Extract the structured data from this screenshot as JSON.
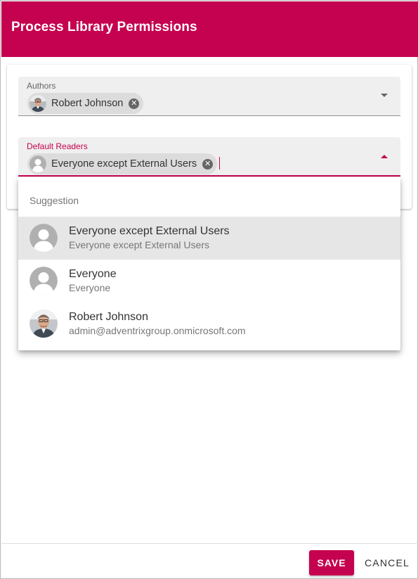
{
  "dialog": {
    "title": "Process Library Permissions",
    "accent_color": "#c5024f"
  },
  "authors": {
    "label": "Authors",
    "chips": [
      {
        "name": "Robert Johnson",
        "avatar": "user-photo"
      }
    ]
  },
  "default_readers": {
    "label": "Default Readers",
    "chips": [
      {
        "name": "Everyone except External Users",
        "avatar": "generic-user-icon"
      }
    ]
  },
  "suggestions": {
    "heading": "Suggestion",
    "items": [
      {
        "primary": "Everyone except External Users",
        "secondary": "Everyone except External Users",
        "avatar": "generic-user-icon"
      },
      {
        "primary": "Everyone",
        "secondary": "Everyone",
        "avatar": "generic-user-icon"
      },
      {
        "primary": "Robert Johnson",
        "secondary": "admin@adventrixgroup.onmicrosoft.com",
        "avatar": "user-photo"
      }
    ]
  },
  "footer": {
    "save_label": "SAVE",
    "cancel_label": "CANCEL"
  }
}
